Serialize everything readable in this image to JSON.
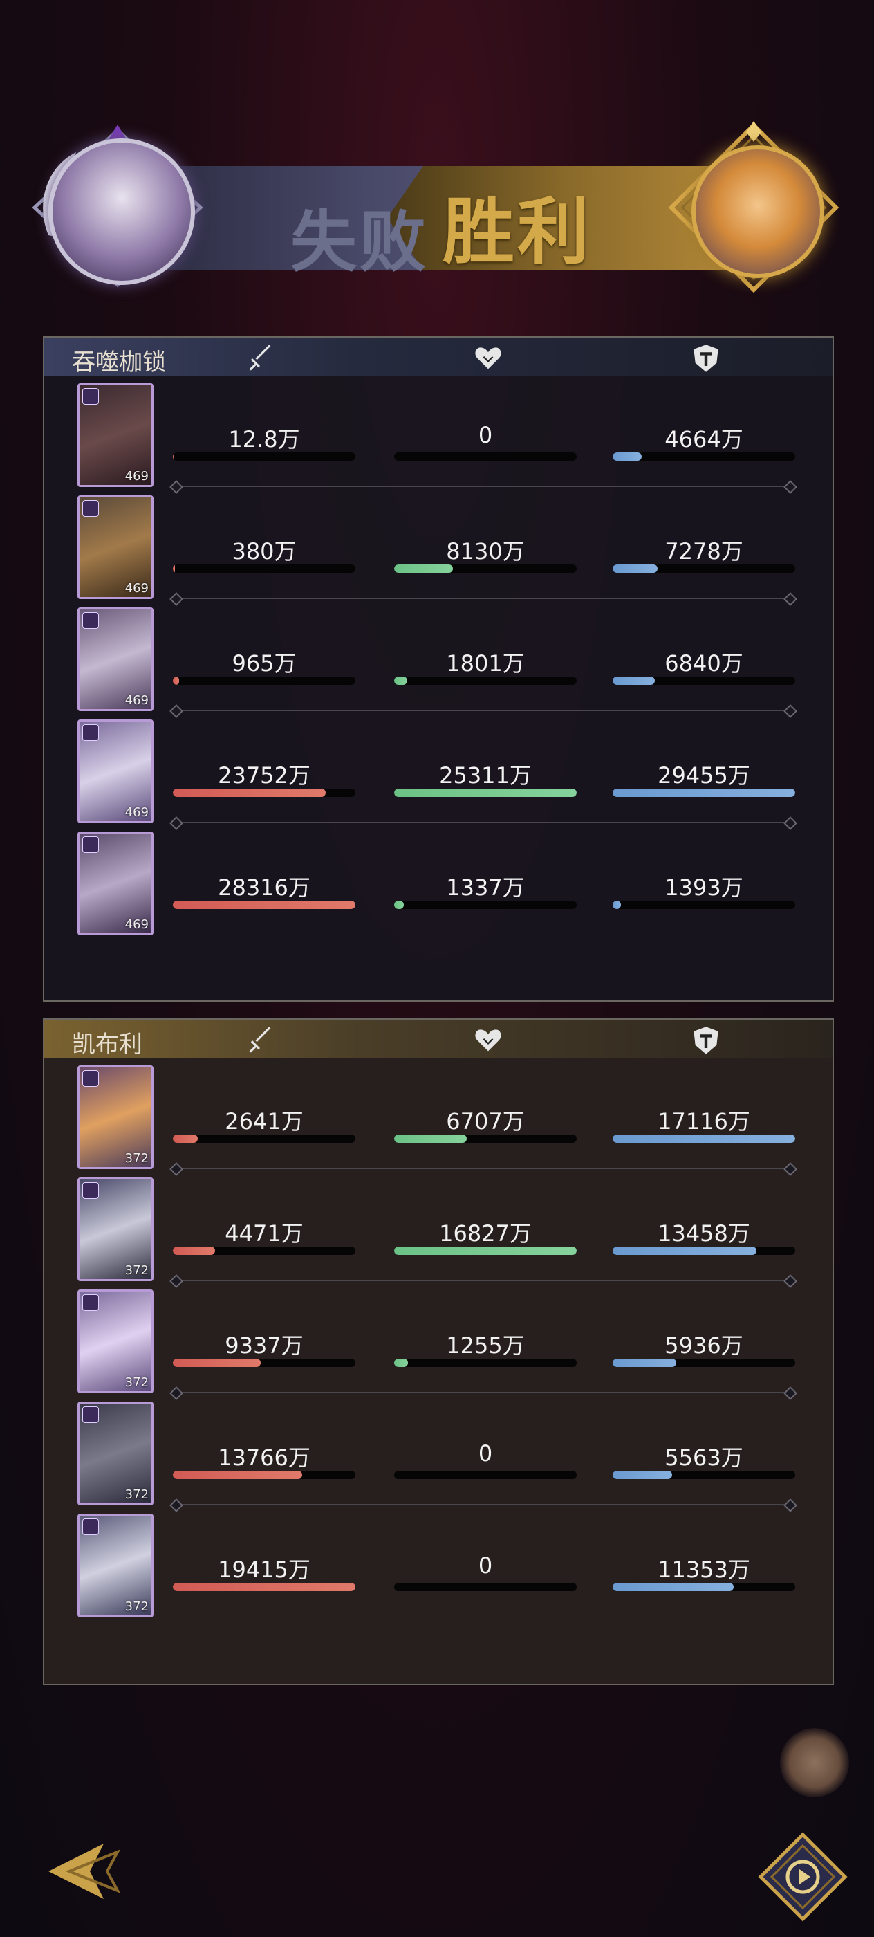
{
  "banner": {
    "lose_label": "失败",
    "win_label": "胜利"
  },
  "colors": {
    "damage": "#d25b55",
    "healing": "#6cc286",
    "tanking": "#6a9ad0",
    "win_gold": "#d4a94a"
  },
  "icons": {
    "column_1": "sword-icon",
    "column_2": "heart-icon",
    "column_3": "shield-icon"
  },
  "team_left": {
    "name": "吞噬枷锁",
    "heroes": [
      {
        "level": "469",
        "damage": "12.8万",
        "damage_pct": 0.45,
        "healing": "0",
        "healing_pct": 0,
        "tank": "4664万",
        "tank_pct": 15.8
      },
      {
        "level": "469",
        "damage": "380万",
        "damage_pct": 1.3,
        "healing": "8130万",
        "healing_pct": 32.1,
        "tank": "7278万",
        "tank_pct": 24.7
      },
      {
        "level": "469",
        "damage": "965万",
        "damage_pct": 3.4,
        "healing": "1801万",
        "healing_pct": 7.1,
        "tank": "6840万",
        "tank_pct": 23.2
      },
      {
        "level": "469",
        "damage": "23752万",
        "damage_pct": 83.9,
        "healing": "25311万",
        "healing_pct": 100,
        "tank": "29455万",
        "tank_pct": 100
      },
      {
        "level": "469",
        "damage": "28316万",
        "damage_pct": 100,
        "healing": "1337万",
        "healing_pct": 5.3,
        "tank": "1393万",
        "tank_pct": 4.7
      }
    ]
  },
  "team_right": {
    "name": "凯布利",
    "heroes": [
      {
        "level": "372",
        "damage": "2641万",
        "damage_pct": 13.6,
        "healing": "6707万",
        "healing_pct": 39.9,
        "tank": "17116万",
        "tank_pct": 100
      },
      {
        "level": "372",
        "damage": "4471万",
        "damage_pct": 23.0,
        "healing": "16827万",
        "healing_pct": 100,
        "tank": "13458万",
        "tank_pct": 78.6
      },
      {
        "level": "372",
        "damage": "9337万",
        "damage_pct": 48.1,
        "healing": "1255万",
        "healing_pct": 7.5,
        "tank": "5936万",
        "tank_pct": 34.7
      },
      {
        "level": "372",
        "damage": "13766万",
        "damage_pct": 70.9,
        "healing": "0",
        "healing_pct": 0,
        "tank": "5563万",
        "tank_pct": 32.5
      },
      {
        "level": "372",
        "damage": "19415万",
        "damage_pct": 100,
        "healing": "0",
        "healing_pct": 0,
        "tank": "11353万",
        "tank_pct": 66.3
      }
    ]
  }
}
